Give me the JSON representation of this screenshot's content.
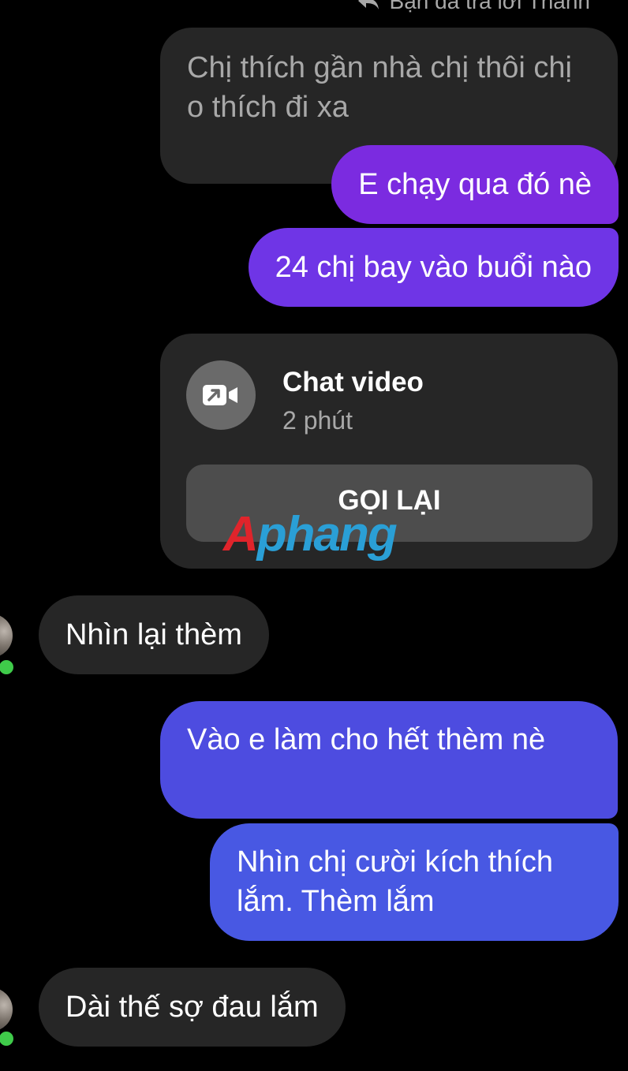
{
  "reply_note": {
    "icon": "reply-arrow-icon",
    "text": "Bạn đã trả lời Thanh"
  },
  "messages": [
    {
      "id": "quoted",
      "direction": "incoming",
      "text": "Chị thích gần nhà chị thôi chị o thích đi xa"
    },
    {
      "id": "out_1",
      "direction": "outgoing",
      "text": "E chạy qua đó nè"
    },
    {
      "id": "out_2",
      "direction": "outgoing",
      "text": "24 chị bay vào buổi nào"
    },
    {
      "id": "in_1",
      "direction": "incoming",
      "text": "Nhìn lại thèm"
    },
    {
      "id": "out_3",
      "direction": "outgoing",
      "text": "Vào e làm cho hết thèm nè"
    },
    {
      "id": "out_4",
      "direction": "outgoing",
      "text": "Nhìn chị cười kích thích lắm. Thèm lắm"
    },
    {
      "id": "in_2",
      "direction": "incoming",
      "text": "Dài thế sợ đau lắm"
    }
  ],
  "call_card": {
    "icon": "video-call-icon",
    "title": "Chat video",
    "duration": "2 phút",
    "button_label": "GỌI LẠI"
  },
  "watermark": {
    "first_letter": "A",
    "rest": "phang"
  },
  "colors": {
    "background": "#000000",
    "incoming_bubble": "#262626",
    "outgoing_purple": "#7b2be0",
    "outgoing_blue": "#4d4ce0",
    "online": "#3fcb4a"
  }
}
